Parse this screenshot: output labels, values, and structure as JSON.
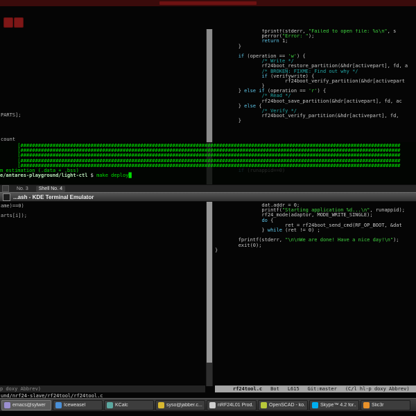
{
  "status_bar": {
    "color": "#3a0b0b"
  },
  "konsole": {
    "title": "...ash - KDE Terminal Emulator",
    "tabs": [
      {
        "label": "No. 3"
      },
      {
        "label": "Shell No. 4"
      }
    ],
    "lines": [
      [
        [
          "      [##################################################################################################################################",
          "g"
        ]
      ],
      [
        [
          "      [##################################################################################################################################",
          "g"
        ]
      ],
      [
        [
          "      [##################################################################################################################################",
          "g"
        ]
      ],
      [
        [
          "      [##################################################################################################################################",
          "g"
        ]
      ],
      [
        [
          "      [##################################################################################################################################",
          "g"
        ]
      ],
      [
        [
          "m estimation (.data + .bss)",
          "g"
        ]
      ],
      [
        [
          "e/antares-playground/light-ctl",
          "pb"
        ],
        [
          " $ ",
          "w"
        ],
        [
          "make deploy",
          "g"
        ],
        [
          "█",
          "g"
        ]
      ]
    ]
  },
  "emacs": {
    "left_fragments": [
      "PARTS];",
      "count",
      "ame)==0)",
      "arts[i]);"
    ],
    "top_code": [
      [
        [
          "                fprintf(stderr, ",
          "d"
        ],
        [
          "\"Failed to open file: %s\\n\"",
          "s"
        ],
        [
          ", s",
          "d"
        ]
      ],
      [
        [
          "                perror(",
          "d"
        ],
        [
          "\"Error: \"",
          "s"
        ],
        [
          ");",
          "d"
        ]
      ],
      [
        [
          "                ",
          "d"
        ],
        [
          "return",
          "k"
        ],
        [
          " 1;",
          "d"
        ]
      ],
      [
        [
          "        }",
          "d"
        ]
      ],
      [],
      [
        [
          "        ",
          "d"
        ],
        [
          "if",
          "k"
        ],
        [
          " (operation == ",
          "d"
        ],
        [
          "'w'",
          "s"
        ],
        [
          ") {",
          "d"
        ]
      ],
      [
        [
          "                ",
          "d"
        ],
        [
          "/* Write */",
          "c"
        ]
      ],
      [
        [
          "                rf24boot_restore_partition(&hdr[activepart], fd, a",
          "d"
        ]
      ],
      [
        [
          "                ",
          "d"
        ],
        [
          "/* BROKEN: FIXME: Find out why */",
          "c"
        ]
      ],
      [
        [
          "                ",
          "d"
        ],
        [
          "if",
          "k"
        ],
        [
          " (verifywrite) {",
          "d"
        ]
      ],
      [
        [
          "                        rf24boot_verify_partition(&hdr[activepart",
          "d"
        ]
      ],
      [
        [
          "                }",
          "d"
        ]
      ],
      [
        [
          "        } ",
          "d"
        ],
        [
          "else",
          "k"
        ],
        [
          " ",
          "d"
        ],
        [
          "if",
          "k"
        ],
        [
          " (operation == ",
          "d"
        ],
        [
          "'r'",
          "s"
        ],
        [
          ") {",
          "d"
        ]
      ],
      [
        [
          "                ",
          "d"
        ],
        [
          "/* Read */",
          "c"
        ]
      ],
      [
        [
          "                rf24boot_save_partition(&hdr[activepart], fd, ac",
          "d"
        ]
      ],
      [
        [
          "        } ",
          "d"
        ],
        [
          "else",
          "k"
        ],
        [
          " {",
          "d"
        ]
      ],
      [
        [
          "                ",
          "d"
        ],
        [
          "/* Verify */",
          "c"
        ]
      ],
      [
        [
          "                rf24boot_verify_partition(&hdr[activepart], fd, ",
          "d"
        ]
      ],
      [
        [
          "        }",
          "d"
        ]
      ],
      [],
      [],
      [],
      [],
      [],
      [],
      [],
      [],
      [],
      [
        [
          "        ",
          "d"
        ],
        [
          "if",
          "k"
        ],
        [
          " (runappid==0)",
          "d"
        ]
      ]
    ],
    "bottom_code": [
      [
        [
          "                dat.addr = 0;",
          "d"
        ]
      ],
      [
        [
          "                printf(",
          "d"
        ],
        [
          "\"Starting application %d...\\n\"",
          "s"
        ],
        [
          ", runappid);",
          "d"
        ]
      ],
      [
        [
          "                rf24_mode(adaptor, MODE_WRITE_SINGLE);",
          "d"
        ]
      ],
      [
        [
          "                ",
          "d"
        ],
        [
          "do",
          "k"
        ],
        [
          " { ",
          "d"
        ]
      ],
      [
        [
          "                        ret = rf24boot_send_cmd(RF_OP_BOOT, &dat",
          "d"
        ]
      ],
      [
        [
          "                } ",
          "d"
        ],
        [
          "while",
          "k"
        ],
        [
          " (ret != 0) ;",
          "d"
        ]
      ],
      [],
      [
        [
          "        fprintf(stderr, ",
          "d"
        ],
        [
          "\"\\n\\nWe are done! Have a nice day!\\n\"",
          "s"
        ],
        [
          ");",
          "d"
        ]
      ],
      [
        [
          "        exit(0);",
          "d"
        ]
      ],
      [
        [
          "}",
          "d"
        ]
      ]
    ],
    "modeline_left": "p doxy Abbrev)",
    "modeline_right": {
      "buffer": "rf24tool.c",
      "position": "Bot",
      "line": "L615",
      "vc": "Git:master",
      "modes": "(C/l hl-p doxy Abbrev)"
    },
    "echo_area": "und/nrf24-slave/rf24tool/rf24tool.c"
  },
  "taskbar": {
    "buttons": [
      {
        "label": "emacs@sylwer",
        "icon": "emacs-icon",
        "color": "#9b8fd0",
        "active": true
      },
      {
        "label": "Iceweasel",
        "icon": "iceweasel-icon",
        "color": "#4a90d9",
        "active": false
      },
      {
        "label": "KCalc",
        "icon": "kcalc-icon",
        "color": "#5ba8a0",
        "active": false
      },
      {
        "label": "syso@jabber.c...",
        "icon": "jabber-icon",
        "color": "#d8b830",
        "active": false
      },
      {
        "label": "nRF24L01 Prod...",
        "icon": "document-icon",
        "color": "#cfcfcf",
        "active": false
      },
      {
        "label": "OpenSCAD - ko...",
        "icon": "openscad-icon",
        "color": "#b8c83a",
        "active": false
      },
      {
        "label": "Skype™ 4.2 for...",
        "icon": "skype-icon",
        "color": "#00aff0",
        "active": false
      },
      {
        "label": "Slic3r",
        "icon": "slic3r-icon",
        "color": "#e8912a",
        "active": false
      }
    ]
  },
  "colors": {
    "terminal_green": "#00df00",
    "string_green": "#3fd23f",
    "comment_teal": "#23a5a5",
    "keyword_cyan": "#5fc7ea",
    "modeline_active_bg": "#a6a6a6",
    "panel_bg": "#383838",
    "topbar_red": "#3a0b0b"
  }
}
